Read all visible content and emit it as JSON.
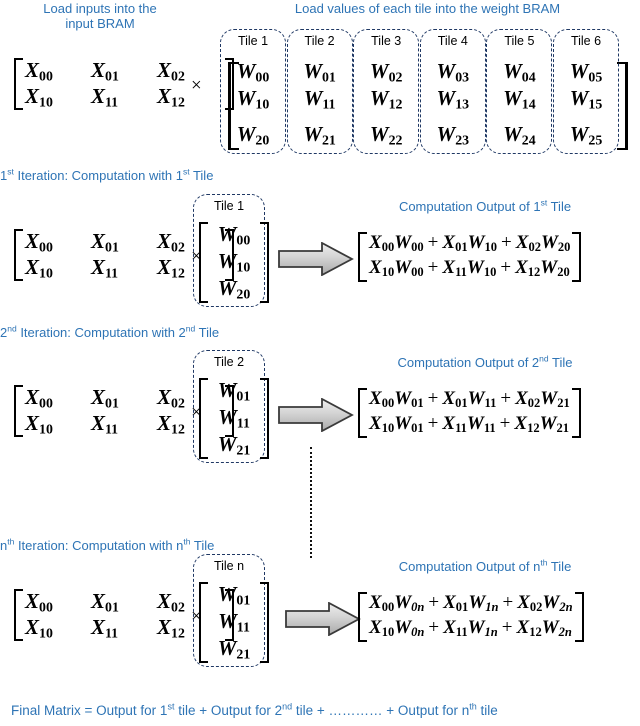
{
  "meta": {
    "accent_color": "#2E74B5",
    "tile_border_color": "#1F3864",
    "arrow_fill": "#C8C8C8",
    "arrow_stroke": "#3A3A3A"
  },
  "captions": {
    "load_inputs_line1": "Load inputs into the",
    "load_inputs_line2": "input BRAM",
    "load_weights": "Load values of each tile into the weight BRAM",
    "iter1_header_pre": "1",
    "iter1_header_sup": "st",
    "iter1_header_mid": " Iteration: Computation with 1",
    "iter1_header_sup2": "st",
    "iter1_header_end": " Tile",
    "iter2_header_pre": "2",
    "iter2_header_sup": "nd",
    "iter2_header_mid": " Iteration: Computation with 2",
    "iter2_header_sup2": "nd",
    "iter2_header_end": " Tile",
    "itern_header_pre": "n",
    "itern_header_sup": "th",
    "itern_header_mid": " Iteration: Computation with n",
    "itern_header_sup2": "th",
    "itern_header_end": " Tile",
    "out1_pre": "Computation Output of 1",
    "out1_sup": "st",
    "out1_end": " Tile",
    "out2_pre": "Computation Output of 2",
    "out2_sup": "nd",
    "out2_end": " Tile",
    "outn_pre": "Computation Output of n",
    "outn_sup": "th",
    "outn_end": " Tile"
  },
  "input_matrix": {
    "label": "X",
    "rows": [
      [
        "X00",
        "X01",
        "X02"
      ],
      [
        "X10",
        "X11",
        "X12"
      ]
    ],
    "cells": [
      [
        {
          "v": "X",
          "s": "00"
        },
        {
          "v": "X",
          "s": "01"
        },
        {
          "v": "X",
          "s": "02"
        }
      ],
      [
        {
          "v": "X",
          "s": "10"
        },
        {
          "v": "X",
          "s": "11"
        },
        {
          "v": "X",
          "s": "12"
        }
      ]
    ]
  },
  "multiply_symbol": "×",
  "weight_bram": {
    "tiles": [
      {
        "label": "Tile 1",
        "values": [
          {
            "v": "W",
            "s": "00"
          },
          {
            "v": "W",
            "s": "10"
          },
          {
            "v": "W",
            "s": "20"
          }
        ]
      },
      {
        "label": "Tile 2",
        "values": [
          {
            "v": "W",
            "s": "01"
          },
          {
            "v": "W",
            "s": "11"
          },
          {
            "v": "W",
            "s": "21"
          }
        ]
      },
      {
        "label": "Tile 3",
        "values": [
          {
            "v": "W",
            "s": "02"
          },
          {
            "v": "W",
            "s": "12"
          },
          {
            "v": "W",
            "s": "22"
          }
        ]
      },
      {
        "label": "Tile 4",
        "values": [
          {
            "v": "W",
            "s": "03"
          },
          {
            "v": "W",
            "s": "13"
          },
          {
            "v": "W",
            "s": "23"
          }
        ]
      },
      {
        "label": "Tile 5",
        "values": [
          {
            "v": "W",
            "s": "04"
          },
          {
            "v": "W",
            "s": "14"
          },
          {
            "v": "W",
            "s": "24"
          }
        ]
      },
      {
        "label": "Tile 6",
        "values": [
          {
            "v": "W",
            "s": "05"
          },
          {
            "v": "W",
            "s": "15"
          },
          {
            "v": "W",
            "s": "25"
          }
        ]
      }
    ]
  },
  "iterations": [
    {
      "id": "iter1",
      "tile_label": "Tile 1",
      "tile_values": [
        {
          "v": "W",
          "s": "00"
        },
        {
          "v": "W",
          "s": "10"
        },
        {
          "v": "W",
          "s": "20"
        }
      ],
      "output_rows": [
        [
          {
            "a": "X",
            "as": "00",
            "b": "W",
            "bs": "00"
          },
          {
            "a": "X",
            "as": "01",
            "b": "W",
            "bs": "10"
          },
          {
            "a": "X",
            "as": "02",
            "b": "W",
            "bs": "20"
          }
        ],
        [
          {
            "a": "X",
            "as": "10",
            "b": "W",
            "bs": "00"
          },
          {
            "a": "X",
            "as": "11",
            "b": "W",
            "bs": "10"
          },
          {
            "a": "X",
            "as": "12",
            "b": "W",
            "bs": "20"
          }
        ]
      ],
      "output_text": [
        "X00W00 + X01W10 + X02W20",
        "X10W00 + X11W10 + X12W20"
      ]
    },
    {
      "id": "iter2",
      "tile_label": "Tile 2",
      "tile_values": [
        {
          "v": "W",
          "s": "01"
        },
        {
          "v": "W",
          "s": "11"
        },
        {
          "v": "W",
          "s": "21"
        }
      ],
      "output_rows": [
        [
          {
            "a": "X",
            "as": "00",
            "b": "W",
            "bs": "01"
          },
          {
            "a": "X",
            "as": "01",
            "b": "W",
            "bs": "11"
          },
          {
            "a": "X",
            "as": "02",
            "b": "W",
            "bs": "21"
          }
        ],
        [
          {
            "a": "X",
            "as": "10",
            "b": "W",
            "bs": "01"
          },
          {
            "a": "X",
            "as": "11",
            "b": "W",
            "bs": "11"
          },
          {
            "a": "X",
            "as": "12",
            "b": "W",
            "bs": "21"
          }
        ]
      ],
      "output_text": [
        "X00W01 + X01W11 + X02W21",
        "X10W01 + X11W11 + X12W21"
      ]
    },
    {
      "id": "itern",
      "tile_label": "Tile n",
      "tile_values": [
        {
          "v": "W",
          "s": "01"
        },
        {
          "v": "W",
          "s": "11"
        },
        {
          "v": "W",
          "s": "21"
        }
      ],
      "output_rows": [
        [
          {
            "a": "X",
            "as": "00",
            "b": "W",
            "bs": "0n",
            "bsi": true
          },
          {
            "a": "X",
            "as": "01",
            "b": "W",
            "bs": "1n",
            "bsi": true
          },
          {
            "a": "X",
            "as": "02",
            "b": "W",
            "bs": "2n",
            "bsi": true
          }
        ],
        [
          {
            "a": "X",
            "as": "10",
            "b": "W",
            "bs": "0n",
            "bsi": true
          },
          {
            "a": "X",
            "as": "11",
            "b": "W",
            "bs": "1n",
            "bsi": true
          },
          {
            "a": "X",
            "as": "12",
            "b": "W",
            "bs": "2n",
            "bsi": true
          }
        ]
      ],
      "output_text": [
        "X00W0n + X01W1n + X02W2n",
        "X10W0n + X11W1n + X12W2n"
      ]
    }
  ],
  "footer": {
    "pre": "Final Matrix = Output for 1",
    "sup1": "st",
    "mid1": " tile + Output for 2",
    "sup2": "nd",
    "mid2": " tile + ………… + Output for n",
    "sup3": "th",
    "end": " tile"
  },
  "plus_symbol": "+"
}
